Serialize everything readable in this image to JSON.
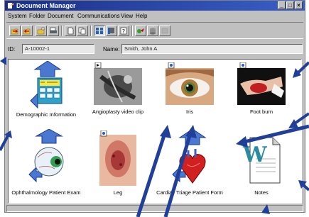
{
  "window": {
    "title": "Document Manager",
    "controls": [
      "_",
      "□",
      "×"
    ]
  },
  "menu": [
    "System",
    "Folder",
    "Document",
    "Communications",
    "View",
    "Help"
  ],
  "toolbar": {
    "buttons": [
      {
        "icon": "open-folder-arrow-icon"
      },
      {
        "icon": "folder-arrow-icon"
      },
      {
        "icon": "new-folder-icon"
      },
      {
        "icon": "print-icon"
      },
      {
        "icon": "new-document-icon"
      },
      {
        "icon": "copy-document-icon"
      },
      {
        "icon": "large-icons-view-icon",
        "active": true
      },
      {
        "icon": "details-view-icon"
      },
      {
        "icon": "help-icon"
      },
      {
        "icon": "send-icon"
      },
      {
        "icon": "database-icon"
      },
      {
        "icon": "disabled-tool-icon"
      }
    ]
  },
  "record": {
    "id_label": "ID:",
    "id_value": "A-10002-1",
    "name_label": "Name:",
    "name_value": "Smith, John A"
  },
  "documents": [
    {
      "label": "Demographic Information",
      "type": "form"
    },
    {
      "label": "Angioplasty video clip",
      "type": "video"
    },
    {
      "label": "Iris",
      "type": "image"
    },
    {
      "label": "Foot burn",
      "type": "image"
    },
    {
      "label": "Ophthalmology Patient Exam",
      "type": "form"
    },
    {
      "label": "Leg",
      "type": "image"
    },
    {
      "label": "Cardiac Triage Patient Form",
      "type": "form"
    },
    {
      "label": "Notes",
      "type": "word-document"
    }
  ],
  "colors": {
    "titlebar": "#1b2f86",
    "window": "#c0c0c0",
    "callout_arrows": "#1f3f99"
  }
}
